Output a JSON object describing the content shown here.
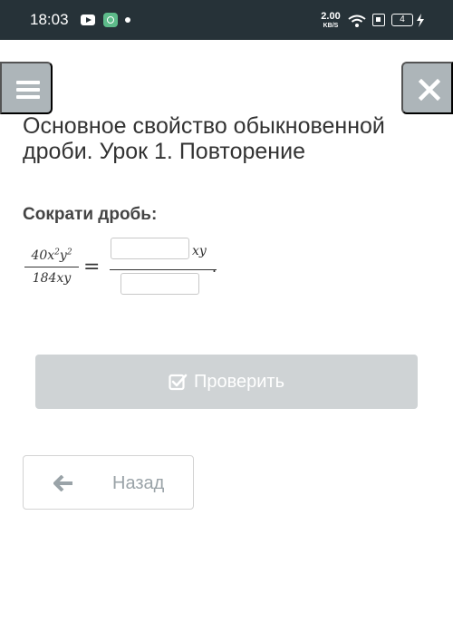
{
  "status_bar": {
    "time": "18:03",
    "speed_value": "2.00",
    "speed_unit": "KB/S",
    "battery": "4"
  },
  "header": {
    "menu_icon": "hamburger-icon",
    "close_icon": "close-icon"
  },
  "lesson": {
    "title": "Основное свойство обыкновенной дроби. Урок 1. Повторение"
  },
  "task": {
    "prompt": "Сократи дробь:",
    "left_numerator_coef": "40",
    "left_numerator_x": "x",
    "left_numerator_x_exp": "2",
    "left_numerator_y": "y",
    "left_numerator_y_exp": "2",
    "left_denominator": "184xy",
    "equals": "=",
    "numerator_value": "",
    "numerator_variables": "xy",
    "denominator_value": "",
    "period": "."
  },
  "actions": {
    "check_label": "Проверить",
    "back_label": "Назад"
  },
  "colors": {
    "status_bar": "#263238",
    "nav_buttons": "#adb5b9",
    "check_button": "#cfd3d5",
    "back_text": "#9aa3a8"
  }
}
